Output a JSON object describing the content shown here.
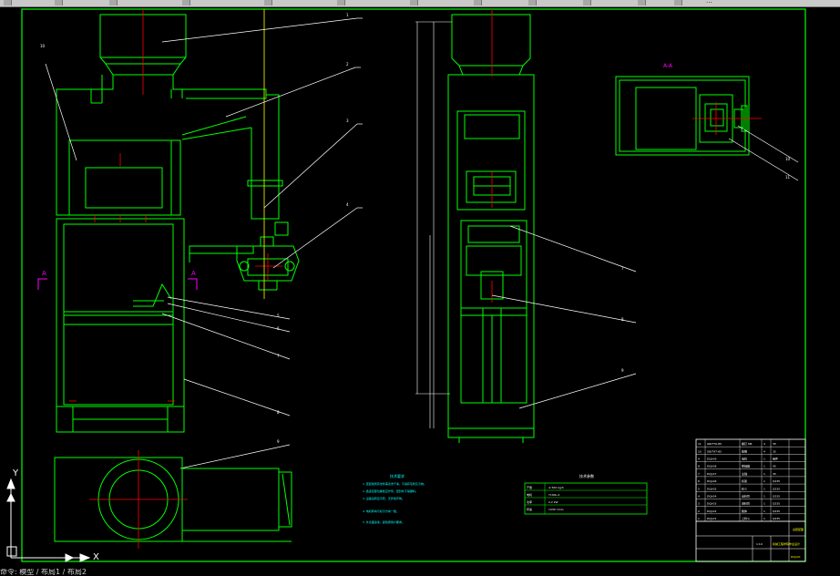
{
  "toolbar": {
    "tool_label": "...",
    "buttons": [
      "btn1",
      "btn2",
      "btn3",
      "btn4",
      "btn5",
      "btn6",
      "btn7",
      "btn8",
      "btn9",
      "btn10",
      "btn11",
      "btn12",
      "btn13",
      "btn14"
    ]
  },
  "drawing": {
    "section_label": "A-A",
    "section_marker_left": "A",
    "section_marker_right": "A",
    "ucs_y": "Y",
    "ucs_x": "X",
    "balloons_left": [
      "1",
      "2",
      "3",
      "4",
      "5",
      "6",
      "7",
      "8",
      "9"
    ],
    "balloons_mid": [
      "7",
      "8",
      "9"
    ],
    "balloons_right": [
      "10",
      "11"
    ],
    "tech_notes_title": "技术要求",
    "tech_notes": [
      "1. 装配前所有零件需清洗干净，不得有毛刺及污物。",
      "2. 各连接部位螺栓应拧紧，密封处不得漏料。",
      "3. 设备运转应平稳，无异常声响。",
      "4. 电机转向与标示方向一致。",
      "5. 外表面涂漆，颜色按用户要求。"
    ],
    "spec_title": "技术参数",
    "spec_rows": [
      [
        "产量",
        "≥ 500 kg/h"
      ],
      [
        "电机",
        "Y100L-4"
      ],
      [
        "功率",
        "2.2 kW"
      ],
      [
        "转速",
        "1430 r/min"
      ]
    ],
    "bom_rows": [
      [
        "11",
        "GB/T70-85",
        "螺钉 M6",
        "4",
        "35"
      ],
      [
        "10",
        "GB/T97-85",
        "垫圈",
        "4",
        "35"
      ],
      [
        "9",
        "DQJ-09",
        "电机",
        "1",
        "组件"
      ],
      [
        "8",
        "DQJ-08",
        "联轴器",
        "1",
        "45"
      ],
      [
        "7",
        "DQJ-07",
        "主轴",
        "1",
        "45"
      ],
      [
        "6",
        "DQJ-06",
        "机架",
        "1",
        "Q235"
      ],
      [
        "5",
        "DQJ-05",
        "料斗",
        "1",
        "Q235"
      ],
      [
        "4",
        "DQJ-04",
        "出料管",
        "1",
        "Q235"
      ],
      [
        "3",
        "DQJ-03",
        "进料管",
        "1",
        "Q235"
      ],
      [
        "2",
        "DQJ-02",
        "箱体",
        "1",
        "Q235"
      ],
      [
        "1",
        "DQJ-01",
        "上料斗",
        "1",
        "Q235"
      ]
    ],
    "title_block": {
      "drawing_name": "总装配图",
      "company": "机械工程学院毕业设计",
      "drawing_no": "DQJ-00",
      "scale": "1:10"
    }
  },
  "status": {
    "text": "命令: 模型 / 布局1 / 布局2"
  },
  "colors": {
    "green": "#00ff00",
    "yellow": "#ffff00",
    "red": "#ff0000",
    "white": "#ffffff",
    "cyan": "#00ffff",
    "magenta": "#ff00ff"
  }
}
